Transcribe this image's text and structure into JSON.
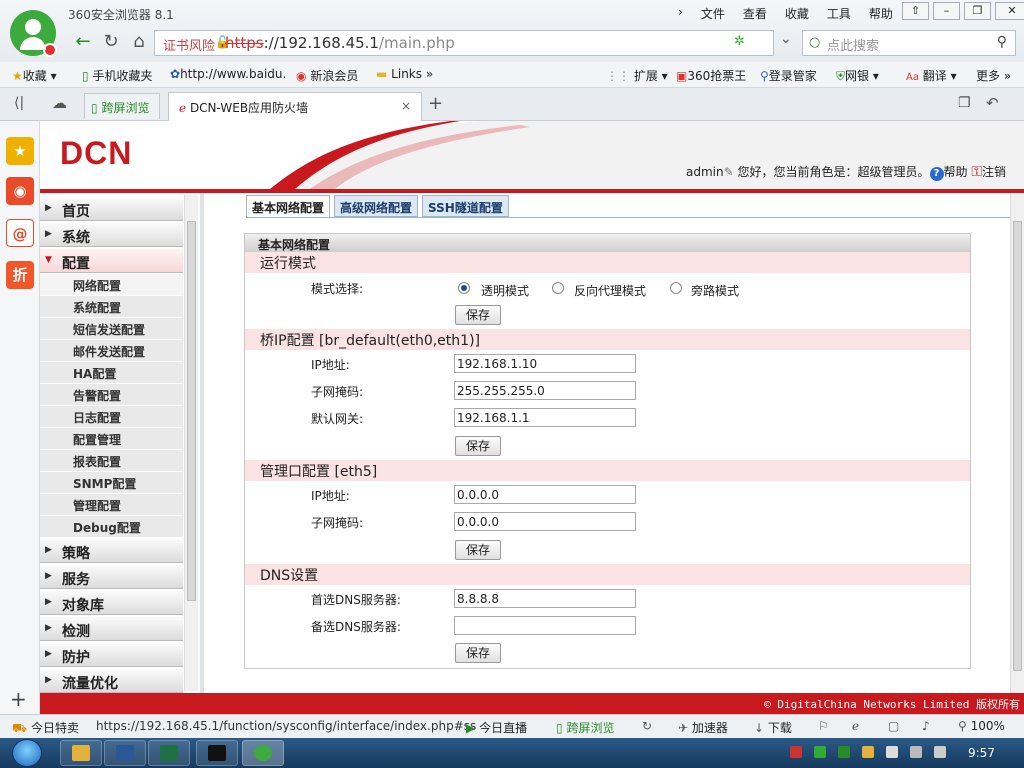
{
  "browser": {
    "title": "360安全浏览器 8.1",
    "menu": [
      "文件",
      "查看",
      "收藏",
      "工具",
      "帮助"
    ],
    "cert_warning": "证书风险",
    "url_scheme": "https",
    "url_host": "://192.168.45.1",
    "url_path": "/main.php",
    "search_placeholder": "点此搜索",
    "bookmarks": [
      "收藏",
      "手机收藏夹",
      "http://www.baidu.",
      "新浪会员",
      "Links",
      "扩展",
      "360抢票王",
      "登录管家",
      "网银",
      "翻译",
      "更多"
    ],
    "tabs": [
      {
        "label": "跨屏浏览"
      },
      {
        "label": "DCN-WEB应用防火墙"
      }
    ]
  },
  "header": {
    "logo": "DCN",
    "user": "admin",
    "greeting": "您好，您当前角色是：超级管理员。",
    "help": "帮助",
    "logout": "注销"
  },
  "nav": {
    "items": [
      {
        "label": "首页"
      },
      {
        "label": "系统"
      },
      {
        "label": "配置"
      },
      {
        "label": "策略"
      },
      {
        "label": "服务"
      },
      {
        "label": "对象库"
      },
      {
        "label": "检测"
      },
      {
        "label": "防护"
      },
      {
        "label": "流量优化"
      }
    ],
    "sub": [
      "网络配置",
      "系统配置",
      "短信发送配置",
      "邮件发送配置",
      "HA配置",
      "告警配置",
      "日志配置",
      "配置管理",
      "报表配置",
      "SNMP配置",
      "管理配置",
      "Debug配置"
    ]
  },
  "content": {
    "tabs": [
      "基本网络配置",
      "高级网络配置",
      "SSH隧道配置"
    ],
    "panel_title": "基本网络配置",
    "save": "保存",
    "run_mode": {
      "title": "运行模式",
      "label": "模式选择:",
      "options": [
        "透明模式",
        "反向代理模式",
        "旁路模式"
      ],
      "selected": "透明模式"
    },
    "bridge": {
      "title": "桥IP配置  [br_default(eth0,eth1)]",
      "ip_label": "IP地址:",
      "ip": "192.168.1.10",
      "mask_label": "子网掩码:",
      "mask": "255.255.255.0",
      "gw_label": "默认网关:",
      "gw": "192.168.1.1"
    },
    "mgmt": {
      "title": "管理口配置  [eth5]",
      "ip_label": "IP地址:",
      "ip": "0.0.0.0",
      "mask_label": "子网掩码:",
      "mask": "0.0.0.0"
    },
    "dns": {
      "title": "DNS设置",
      "primary_label": "首选DNS服务器:",
      "primary": "8.8.8.8",
      "secondary_label": "备选DNS服务器:",
      "secondary": ""
    }
  },
  "footer": "© DigitalChina Networks Limited 版权所有",
  "statusbar": {
    "today": "今日特卖",
    "link": "https://192.168.45.1/function/sysconfig/interface/index.php#ss",
    "live": "今日直播",
    "cross": "跨屏浏览",
    "accel": "加速器",
    "download": "下载",
    "zoom": "100%"
  },
  "taskbar": {
    "clock": "9:57"
  },
  "colors": {
    "brand_red": "#c8191e",
    "section_bg": "#fbe3e3",
    "tab_blue": "#dce8f4"
  }
}
